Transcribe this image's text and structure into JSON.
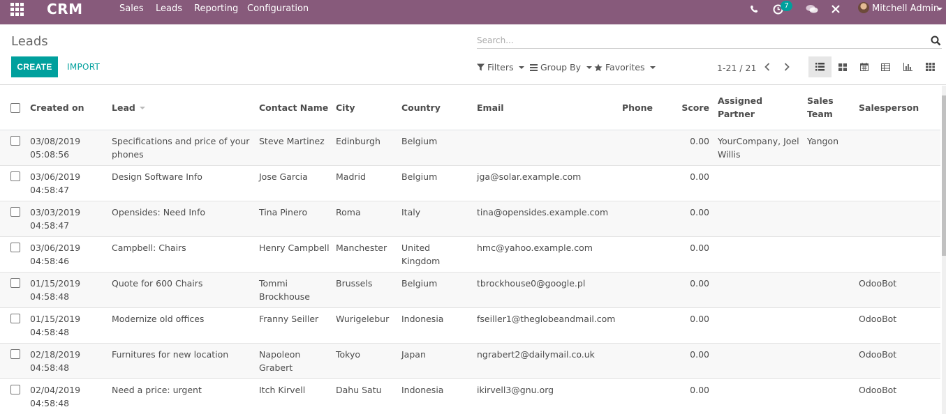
{
  "app": {
    "brand": "CRM",
    "menu": [
      "Sales",
      "Leads",
      "Reporting",
      "Configuration"
    ]
  },
  "systray": {
    "activity_count": "7",
    "user_name": "Mitchell Admin"
  },
  "control_panel": {
    "title": "Leads",
    "create_label": "CREATE",
    "import_label": "IMPORT",
    "search_placeholder": "Search...",
    "filters_label": "Filters",
    "groupby_label": "Group By",
    "favorites_label": "Favorites",
    "pager": "1-21 / 21",
    "views": [
      "list-view",
      "kanban-view",
      "calendar-view",
      "pivot-view",
      "graph-view",
      "grid-view"
    ],
    "active_view": "list-view"
  },
  "table": {
    "columns": [
      "Created on",
      "Lead",
      "Contact Name",
      "City",
      "Country",
      "Email",
      "Phone",
      "Score",
      "Assigned Partner",
      "Sales Team",
      "Salesperson"
    ],
    "rows": [
      {
        "created": "03/08/2019 05:08:56",
        "lead": "Specifications and price of your phones",
        "contact": "Steve Martinez",
        "city": "Edinburgh",
        "country": "Belgium",
        "email": "",
        "phone": "",
        "score": "0.00",
        "partner": "YourCompany, Joel Willis",
        "team": "Yangon",
        "salesperson": ""
      },
      {
        "created": "03/06/2019 04:58:47",
        "lead": "Design Software Info",
        "contact": "Jose Garcia",
        "city": "Madrid",
        "country": "Belgium",
        "email": "jga@solar.example.com",
        "phone": "",
        "score": "0.00",
        "partner": "",
        "team": "",
        "salesperson": ""
      },
      {
        "created": "03/03/2019 04:58:47",
        "lead": "Opensides: Need Info",
        "contact": "Tina Pinero",
        "city": "Roma",
        "country": "Italy",
        "email": "tina@opensides.example.com",
        "phone": "",
        "score": "0.00",
        "partner": "",
        "team": "",
        "salesperson": ""
      },
      {
        "created": "03/06/2019 04:58:46",
        "lead": "Campbell: Chairs",
        "contact": "Henry Campbell",
        "city": "Manchester",
        "country": "United Kingdom",
        "email": "hmc@yahoo.example.com",
        "phone": "",
        "score": "0.00",
        "partner": "",
        "team": "",
        "salesperson": ""
      },
      {
        "created": "01/15/2019 04:58:48",
        "lead": "Quote for 600 Chairs",
        "contact": "Tommi Brockhouse",
        "city": "Brussels",
        "country": "Belgium",
        "email": "tbrockhouse0@google.pl",
        "phone": "",
        "score": "0.00",
        "partner": "",
        "team": "",
        "salesperson": "OdooBot"
      },
      {
        "created": "01/15/2019 04:58:48",
        "lead": "Modernize old offices",
        "contact": "Franny Seiller",
        "city": "Wurigelebur",
        "country": "Indonesia",
        "email": "fseiller1@theglobeandmail.com",
        "phone": "",
        "score": "0.00",
        "partner": "",
        "team": "",
        "salesperson": "OdooBot"
      },
      {
        "created": "02/18/2019 04:58:48",
        "lead": "Furnitures for new location",
        "contact": "Napoleon Grabert",
        "city": "Tokyo",
        "country": "Japan",
        "email": "ngrabert2@dailymail.co.uk",
        "phone": "",
        "score": "0.00",
        "partner": "",
        "team": "",
        "salesperson": "OdooBot"
      },
      {
        "created": "02/04/2019 04:58:48",
        "lead": "Need a price: urgent",
        "contact": "Itch Kirvell",
        "city": "Dahu Satu",
        "country": "Indonesia",
        "email": "ikirvell3@gnu.org",
        "phone": "",
        "score": "0.00",
        "partner": "",
        "team": "",
        "salesperson": "OdooBot"
      }
    ]
  },
  "colors": {
    "brand": "#875a7b",
    "accent": "#00a09d"
  }
}
